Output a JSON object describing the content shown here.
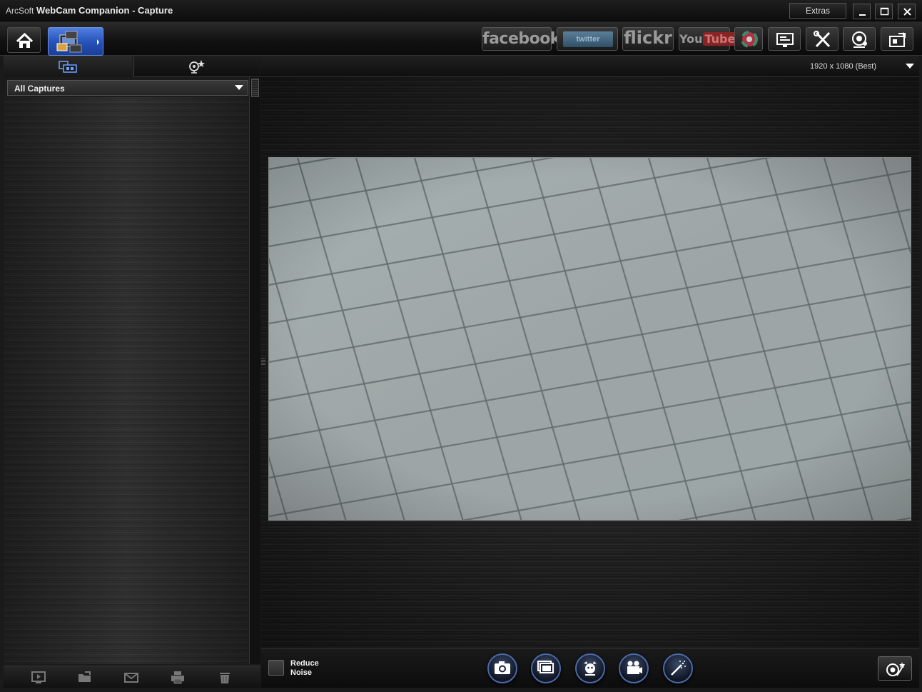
{
  "window": {
    "brand_small": "ArcSoft",
    "brand_bold": "WebCam Companion",
    "mode": "- Capture",
    "extras_label": "Extras"
  },
  "toolbar": {
    "facebook_label": "facebook",
    "twitter_label": "twitter",
    "flickr_label": "flickr",
    "youtube_you": "You",
    "youtube_tube": "Tube"
  },
  "left_panel": {
    "filter_selected": "All Captures"
  },
  "right_panel": {
    "resolution": "1920 x 1080 (Best)",
    "reduce_noise_label": "Reduce Noise",
    "reduce_noise_checked": false
  },
  "colors": {
    "accent_blue": "#2e5ed0",
    "bg_dark": "#1a1a1a"
  }
}
